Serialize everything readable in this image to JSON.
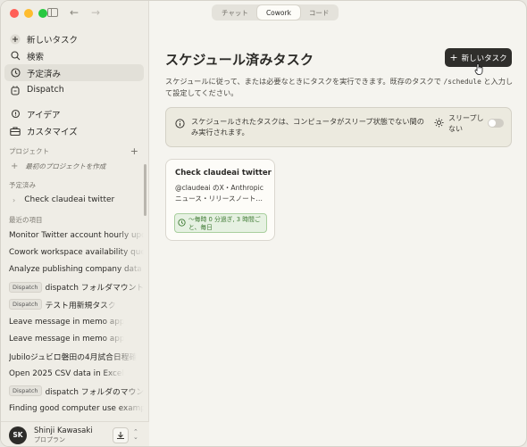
{
  "tabs": [
    "チャット",
    "Cowork",
    "コード"
  ],
  "active_tab": "Cowork",
  "sidebar": {
    "nav": [
      {
        "label": "新しいタスク",
        "icon": "plus-circle-icon"
      },
      {
        "label": "検索",
        "icon": "search-icon"
      },
      {
        "label": "予定済み",
        "icon": "clock-icon",
        "active": true
      },
      {
        "label": "Dispatch",
        "icon": "dispatch-icon"
      }
    ],
    "nav2": [
      {
        "label": "アイデア",
        "icon": "lightbulb-icon"
      },
      {
        "label": "カスタマイズ",
        "icon": "briefcase-icon"
      }
    ],
    "projects_heading": "プロジェクト",
    "project_create": "最初のプロジェクトを作成",
    "scheduled_heading": "予定済み",
    "scheduled_item": "Check claudeai twitter",
    "recent_heading": "最近の項目",
    "recent": [
      {
        "tag": "",
        "label": "Monitor Twitter account hourly upd"
      },
      {
        "tag": "",
        "label": "Cowork workspace availability que"
      },
      {
        "tag": "",
        "label": "Analyze publishing company data a"
      },
      {
        "tag": "Dispatch",
        "label": "dispatch フォルダマウント"
      },
      {
        "tag": "Dispatch",
        "label": "テスト用新規タスク"
      },
      {
        "tag": "",
        "label": "Leave message in memo app"
      },
      {
        "tag": "",
        "label": "Leave message in memo app"
      },
      {
        "tag": "",
        "label": "Jubiloジュビロ磐田の4月試合日程確"
      },
      {
        "tag": "",
        "label": "Open 2025 CSV data in Excel"
      },
      {
        "tag": "Dispatch",
        "label": "dispatch フォルダのマウン"
      },
      {
        "tag": "",
        "label": "Finding good computer use examp"
      }
    ],
    "profile": {
      "initials": "SK",
      "name": "Shinji Kawasaki",
      "plan": "プロプラン"
    }
  },
  "main": {
    "title": "スケジュール済みタスク",
    "new_task_label": "新しいタスク",
    "description_1": "スケジュールに従って、または必要なときにタスクを実行できます。既存のタスクで ",
    "description_code": "/schedule",
    "description_2": " と入力して設定してください。",
    "banner_text": "スケジュールされたタスクは、コンピュータがスリープ状態でない間のみ実行されます。",
    "sleep_label": "スリープしない",
    "card": {
      "title": "Check claudeai twitter",
      "desc": "@claudeai のX・Anthropic ニュース・リリースノート…",
      "schedule": "〜毎時 0 分過ぎ, 3 時間ごと、毎日"
    }
  }
}
